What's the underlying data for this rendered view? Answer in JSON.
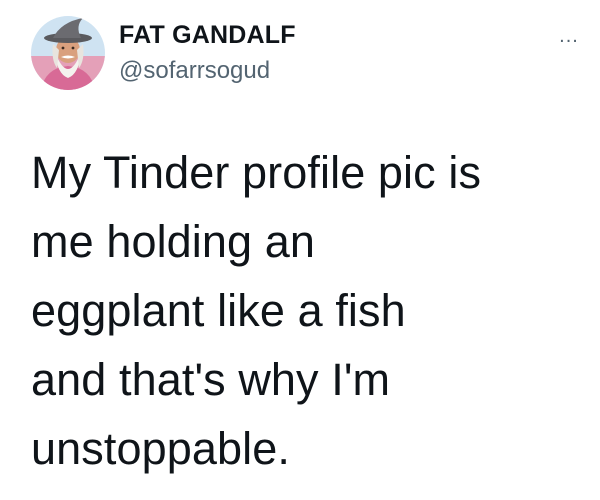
{
  "author": {
    "display_name": "FAT GANDALF",
    "handle": "@sofarrsogud",
    "avatar_icon": "profile-photo-wizard-hat"
  },
  "tweet": {
    "text": "My Tinder profile pic is\nme holding an\neggplant like a fish\nand that's why I'm\nunstoppable."
  },
  "menu": {
    "more_label": "...",
    "more_icon": "more-horizontal-icon"
  },
  "colors": {
    "text_primary": "#0f1419",
    "text_secondary": "#536471",
    "avatar_background": "#cfe3f2"
  }
}
